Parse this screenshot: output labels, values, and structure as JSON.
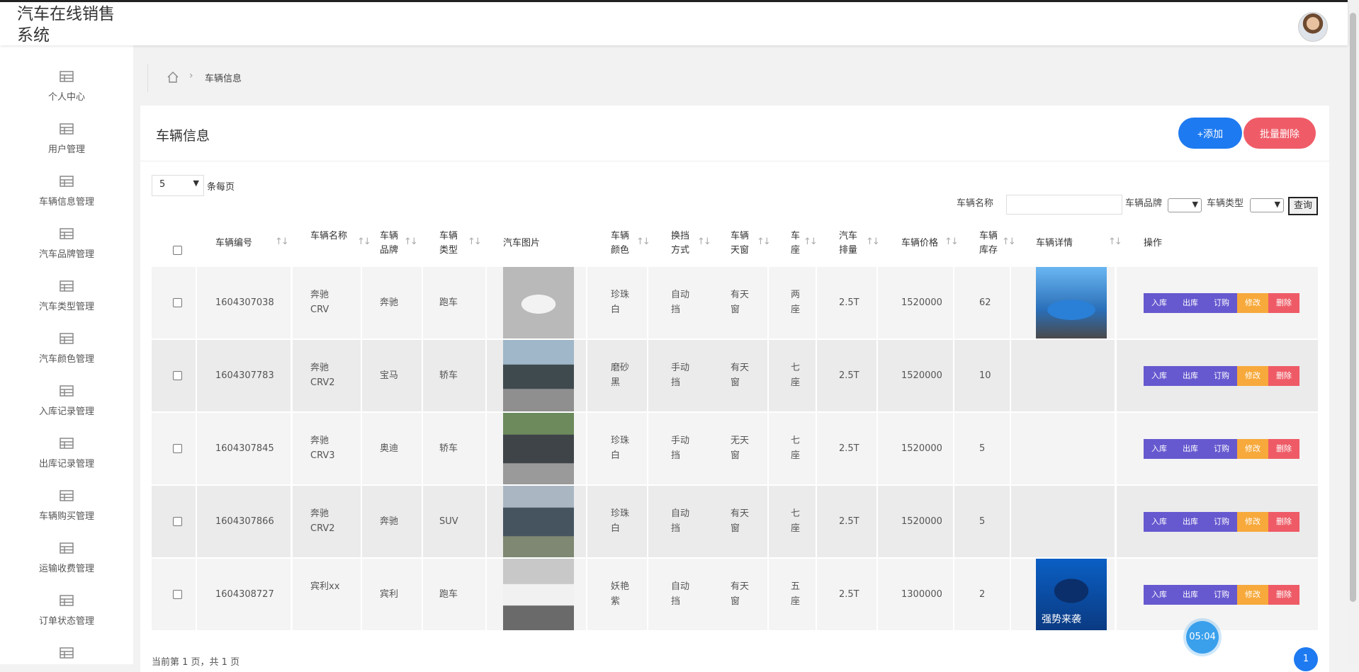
{
  "app": {
    "title": "汽车在线销售系统"
  },
  "sidebar": {
    "items": [
      {
        "label": "个人中心",
        "icon": "table-icon"
      },
      {
        "label": "用户管理",
        "icon": "table-icon"
      },
      {
        "label": "车辆信息管理",
        "icon": "table-icon"
      },
      {
        "label": "汽车品牌管理",
        "icon": "table-icon"
      },
      {
        "label": "汽车类型管理",
        "icon": "table-icon"
      },
      {
        "label": "汽车颜色管理",
        "icon": "table-icon"
      },
      {
        "label": "入库记录管理",
        "icon": "table-icon"
      },
      {
        "label": "出库记录管理",
        "icon": "table-icon"
      },
      {
        "label": "车辆购买管理",
        "icon": "table-icon"
      },
      {
        "label": "运输收费管理",
        "icon": "table-icon"
      },
      {
        "label": "订单状态管理",
        "icon": "table-icon"
      },
      {
        "label": "",
        "icon": "table-icon"
      }
    ]
  },
  "breadcrumb": {
    "current": "车辆信息"
  },
  "card": {
    "title": "车辆信息",
    "add_label": "+添加",
    "batch_delete_label": "批量删除"
  },
  "pagesize": {
    "value": "5",
    "suffix": "条每页"
  },
  "search": {
    "name_label": "车辆名称",
    "name_value": "",
    "brand_label": "车辆品牌",
    "type_label": "车辆类型",
    "query_label": "查询"
  },
  "table": {
    "headers": {
      "id": "车辆编号",
      "name": "车辆名称",
      "brand": "车辆品牌",
      "type": "车辆类型",
      "image": "汽车图片",
      "color": "车辆颜色",
      "gear": "换挡方式",
      "roof": "车辆天窗",
      "seat": "车座",
      "disp": "汽车排量",
      "price": "车辆价格",
      "stock": "车辆库存",
      "detail": "车辆详情",
      "ops": "操作"
    },
    "rows": [
      {
        "id": "1604307038",
        "name": "奔驰CRV",
        "brand": "奔驰",
        "type": "跑车",
        "color": "珍珠白",
        "gear": "自动挡",
        "roof": "有天窗",
        "seat": "两座",
        "disp": "2.5T",
        "price": "1520000",
        "stock": "62",
        "has_detail": true
      },
      {
        "id": "1604307783",
        "name": "奔驰CRV2",
        "brand": "宝马",
        "type": "轿车",
        "color": "磨砂黑",
        "gear": "手动挡",
        "roof": "有天窗",
        "seat": "七座",
        "disp": "2.5T",
        "price": "1520000",
        "stock": "10",
        "has_detail": false
      },
      {
        "id": "1604307845",
        "name": "奔驰CRV3",
        "brand": "奥迪",
        "type": "轿车",
        "color": "珍珠白",
        "gear": "手动挡",
        "roof": "无天窗",
        "seat": "七座",
        "disp": "2.5T",
        "price": "1520000",
        "stock": "5",
        "has_detail": false
      },
      {
        "id": "1604307866",
        "name": "奔驰CRV2",
        "brand": "奔驰",
        "type": "SUV",
        "color": "珍珠白",
        "gear": "自动挡",
        "roof": "有天窗",
        "seat": "七座",
        "disp": "2.5T",
        "price": "1520000",
        "stock": "5",
        "has_detail": false
      },
      {
        "id": "1604308727",
        "name": "宾利xx",
        "brand": "宾利",
        "type": "跑车",
        "color": "妖艳紫",
        "gear": "自动挡",
        "roof": "有天窗",
        "seat": "五座",
        "disp": "2.5T",
        "price": "1300000",
        "stock": "2",
        "has_detail": true
      }
    ],
    "ops": {
      "in": "入库",
      "out": "出库",
      "order": "订购",
      "edit": "修改",
      "delete": "删除"
    },
    "detail_text_row5": "强势来袭"
  },
  "footer": {
    "page_info": "当前第 1 页，共 1 页",
    "page": "1"
  },
  "timer": "05:04",
  "colors": {
    "primary": "#1e7af0",
    "danger": "#ef5c68",
    "op": "#6658cf",
    "warn": "#f7a93b"
  }
}
